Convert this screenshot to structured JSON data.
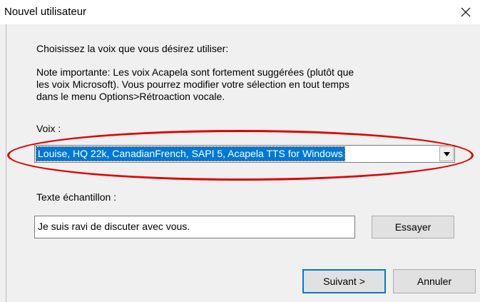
{
  "window": {
    "title": "Nouvel utilisateur",
    "close_icon": "close-icon"
  },
  "instructions": {
    "prompt": "Choisissez la voix que vous désirez utiliser:",
    "note_lines": [
      "Note importante: Les voix Acapela sont fortement suggérées (plutôt que",
      "les voix Microsoft).  Vous pourrez modifier votre sélection en tout temps",
      "dans le menu Options>Rétroaction vocale."
    ]
  },
  "voice": {
    "label": "Voix :",
    "selected": "Louise, HQ 22k, CanadianFrench, SAPI 5, Acapela TTS for Windows",
    "dropdown_icon": "chevron-down-icon"
  },
  "sample": {
    "label": "Texte échantillon :",
    "value": "Je suis ravi de discuter avec vous.",
    "try_label": "Essayer"
  },
  "footer": {
    "next_label": "Suivant >",
    "cancel_label": "Annuler"
  },
  "annotation": {
    "color": "#e00000"
  },
  "colors": {
    "selection": "#0078d7",
    "dialog_bg": "#f0f0f0"
  }
}
